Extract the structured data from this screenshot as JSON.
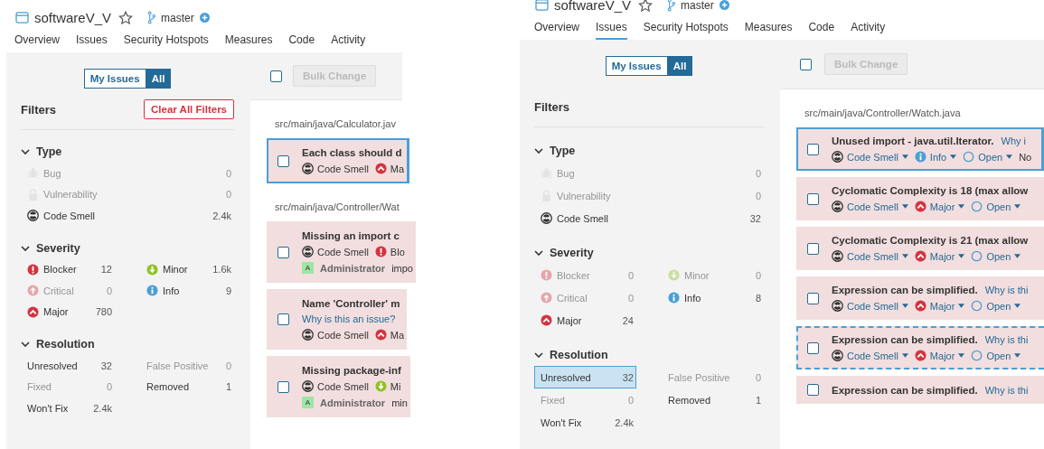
{
  "screens": [
    {
      "project": "softwareV_V",
      "branch": "master",
      "tabs": [
        {
          "label": "Overview",
          "selected": false
        },
        {
          "label": "Issues",
          "selected": false
        },
        {
          "label": "Security Hotspots",
          "selected": false
        },
        {
          "label": "Measures",
          "selected": false
        },
        {
          "label": "Code",
          "selected": false
        },
        {
          "label": "Activity",
          "selected": false
        }
      ],
      "view_toggle": [
        {
          "label": "My Issues",
          "selected": false
        },
        {
          "label": "All",
          "selected": true
        }
      ],
      "filters_title": "Filters",
      "clear_button": "Clear All Filters",
      "facets": [
        {
          "title": "Type",
          "kind": "list",
          "expanded": true,
          "items": [
            {
              "kind": "bug",
              "label": "Bug",
              "count": "0",
              "disabled": true,
              "selected": false
            },
            {
              "kind": "vulnerability",
              "label": "Vulnerability",
              "count": "0",
              "disabled": true,
              "selected": false
            },
            {
              "kind": "code-smell",
              "label": "Code Smell",
              "count": "2.4k",
              "disabled": false,
              "selected": false
            }
          ]
        },
        {
          "title": "Severity",
          "kind": "grid",
          "expanded": true,
          "items": [
            {
              "kind": "blocker",
              "label": "Blocker",
              "count": "12",
              "disabled": false,
              "selected": false
            },
            {
              "kind": "minor",
              "label": "Minor",
              "count": "1.6k",
              "disabled": false,
              "selected": false
            },
            {
              "kind": "critical",
              "label": "Critical",
              "count": "0",
              "disabled": true,
              "selected": false
            },
            {
              "kind": "info",
              "label": "Info",
              "count": "9",
              "disabled": false,
              "selected": false
            },
            {
              "kind": "major",
              "label": "Major",
              "count": "780",
              "disabled": false,
              "selected": false
            }
          ]
        },
        {
          "title": "Resolution",
          "kind": "grid",
          "expanded": true,
          "items": [
            {
              "kind": "plain",
              "label": "Unresolved",
              "count": "32",
              "disabled": false,
              "selected": false
            },
            {
              "kind": "plain",
              "label": "False Positive",
              "count": "0",
              "disabled": true,
              "selected": false
            },
            {
              "kind": "plain",
              "label": "Fixed",
              "count": "0",
              "disabled": true,
              "selected": false
            },
            {
              "kind": "plain",
              "label": "Removed",
              "count": "1",
              "disabled": false,
              "selected": false
            },
            {
              "kind": "plain",
              "label": "Won't Fix",
              "count": "2.4k",
              "disabled": false,
              "selected": false
            }
          ]
        }
      ],
      "select_all_checked": false,
      "bulk_change": "Bulk Change",
      "groups": [
        {
          "file": "src/main/java/Calculator.jav",
          "issues": [
            {
              "title": "Each class should d",
              "focused": true,
              "hovered": false,
              "checked": false,
              "tags": [
                {
                  "kind": "code-smell",
                  "label": "Code Smell",
                  "dropdown": false
                },
                {
                  "kind": "major",
                  "label": "Ma",
                  "dropdown": false
                }
              ]
            }
          ]
        },
        {
          "file": "src/main/java/Controller/Wat",
          "issues": [
            {
              "title": "Missing an import c",
              "focused": false,
              "hovered": false,
              "checked": false,
              "tags": [
                {
                  "kind": "code-smell",
                  "label": "Code Smell",
                  "dropdown": false
                },
                {
                  "kind": "blocker",
                  "label": "Blo",
                  "dropdown": false
                }
              ],
              "assignee": {
                "avatar": "A",
                "name": "Administrator",
                "note": "impo"
              }
            },
            {
              "title": "Name 'Controller' m",
              "link": "Why is this an issue?",
              "link_wrapped": true,
              "focused": false,
              "hovered": false,
              "checked": false,
              "tags": [
                {
                  "kind": "code-smell",
                  "label": "Code Smell",
                  "dropdown": false
                },
                {
                  "kind": "major",
                  "label": "Ma",
                  "dropdown": false
                }
              ]
            },
            {
              "title": "Missing package-inf",
              "focused": false,
              "hovered": false,
              "checked": false,
              "tags": [
                {
                  "kind": "code-smell",
                  "label": "Code Smell",
                  "dropdown": false
                },
                {
                  "kind": "minor",
                  "label": "Mi",
                  "dropdown": false
                }
              ],
              "assignee": {
                "avatar": "A",
                "name": "Administrator",
                "note": "min"
              }
            }
          ]
        }
      ]
    },
    {
      "project": "softwareV_V",
      "branch": "master",
      "tabs": [
        {
          "label": "Overview",
          "selected": false
        },
        {
          "label": "Issues",
          "selected": true
        },
        {
          "label": "Security Hotspots",
          "selected": false
        },
        {
          "label": "Measures",
          "selected": false
        },
        {
          "label": "Code",
          "selected": false
        },
        {
          "label": "Activity",
          "selected": false
        }
      ],
      "view_toggle": [
        {
          "label": "My Issues",
          "selected": false
        },
        {
          "label": "All",
          "selected": true
        }
      ],
      "filters_title": "Filters",
      "facets": [
        {
          "title": "Type",
          "kind": "list",
          "expanded": true,
          "items": [
            {
              "kind": "bug",
              "label": "Bug",
              "count": "0",
              "disabled": true,
              "selected": false
            },
            {
              "kind": "vulnerability",
              "label": "Vulnerability",
              "count": "0",
              "disabled": true,
              "selected": false
            },
            {
              "kind": "code-smell",
              "label": "Code Smell",
              "count": "32",
              "disabled": false,
              "selected": false
            }
          ]
        },
        {
          "title": "Severity",
          "kind": "grid",
          "expanded": true,
          "items": [
            {
              "kind": "blocker",
              "label": "Blocker",
              "count": "0",
              "disabled": true,
              "selected": false
            },
            {
              "kind": "minor",
              "label": "Minor",
              "count": "0",
              "disabled": true,
              "selected": false
            },
            {
              "kind": "critical",
              "label": "Critical",
              "count": "0",
              "disabled": true,
              "selected": false
            },
            {
              "kind": "info",
              "label": "Info",
              "count": "8",
              "disabled": false,
              "selected": false
            },
            {
              "kind": "major",
              "label": "Major",
              "count": "24",
              "disabled": false,
              "selected": false
            }
          ]
        },
        {
          "title": "Resolution",
          "kind": "grid",
          "expanded": true,
          "items": [
            {
              "kind": "plain",
              "label": "Unresolved",
              "count": "32",
              "disabled": false,
              "selected": true
            },
            {
              "kind": "plain",
              "label": "False Positive",
              "count": "0",
              "disabled": true,
              "selected": false
            },
            {
              "kind": "plain",
              "label": "Fixed",
              "count": "0",
              "disabled": true,
              "selected": false
            },
            {
              "kind": "plain",
              "label": "Removed",
              "count": "1",
              "disabled": false,
              "selected": false
            },
            {
              "kind": "plain",
              "label": "Won't Fix",
              "count": "2.4k",
              "disabled": false,
              "selected": false
            }
          ]
        }
      ],
      "select_all_checked": false,
      "bulk_change": "Bulk Change",
      "groups": [
        {
          "file": "src/main/java/Controller/Watch.java",
          "issues": [
            {
              "title": "Unused import - java.util.Iterator.",
              "link": "Why i",
              "link_wrapped": false,
              "focused": true,
              "hovered": false,
              "checked": false,
              "tags": [
                {
                  "kind": "code-smell",
                  "label": "Code Smell",
                  "dropdown": true
                },
                {
                  "kind": "info",
                  "label": "Info",
                  "dropdown": true
                },
                {
                  "kind": "open",
                  "label": "Open",
                  "dropdown": true
                },
                {
                  "kind": "plain",
                  "label": "No",
                  "dropdown": false
                }
              ]
            },
            {
              "title": "Cyclomatic Complexity is 18 (max allow",
              "focused": false,
              "hovered": false,
              "checked": false,
              "tags": [
                {
                  "kind": "code-smell",
                  "label": "Code Smell",
                  "dropdown": true
                },
                {
                  "kind": "major",
                  "label": "Major",
                  "dropdown": true
                },
                {
                  "kind": "open",
                  "label": "Open",
                  "dropdown": true
                }
              ]
            },
            {
              "title": "Cyclomatic Complexity is 21 (max allow",
              "focused": false,
              "hovered": false,
              "checked": false,
              "tags": [
                {
                  "kind": "code-smell",
                  "label": "Code Smell",
                  "dropdown": true
                },
                {
                  "kind": "major",
                  "label": "Major",
                  "dropdown": true
                },
                {
                  "kind": "open",
                  "label": "Open",
                  "dropdown": true
                }
              ]
            },
            {
              "title": "Expression can be simplified.",
              "link": "Why is thi",
              "link_wrapped": false,
              "focused": false,
              "hovered": false,
              "checked": false,
              "tags": [
                {
                  "kind": "code-smell",
                  "label": "Code Smell",
                  "dropdown": true
                },
                {
                  "kind": "major",
                  "label": "Major",
                  "dropdown": true
                },
                {
                  "kind": "open",
                  "label": "Open",
                  "dropdown": true
                }
              ]
            },
            {
              "title": "Expression can be simplified.",
              "link": "Why is thi",
              "link_wrapped": false,
              "focused": false,
              "hovered": true,
              "checked": false,
              "tags": [
                {
                  "kind": "code-smell",
                  "label": "Code Smell",
                  "dropdown": true
                },
                {
                  "kind": "major",
                  "label": "Major",
                  "dropdown": true
                },
                {
                  "kind": "open",
                  "label": "Open",
                  "dropdown": true
                }
              ]
            },
            {
              "title": "Expression can be simplified.",
              "link": "Why is thi",
              "link_wrapped": false,
              "focused": false,
              "hovered": false,
              "checked": false
            }
          ]
        }
      ]
    }
  ]
}
